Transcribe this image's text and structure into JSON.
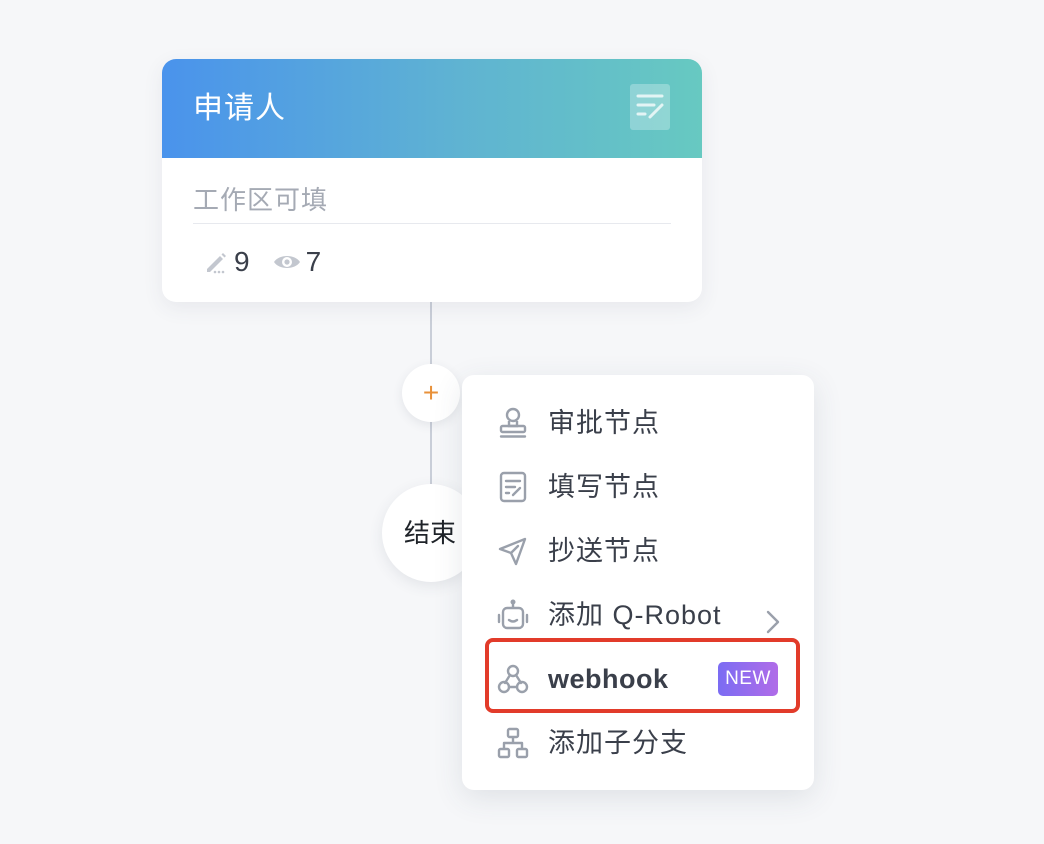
{
  "card": {
    "title": "申请人",
    "header_icon": "form-edit-icon",
    "placeholder": "工作区可填",
    "edit_count": "9",
    "view_count": "7",
    "edit_icon": "pencil-icon",
    "view_icon": "eye-icon"
  },
  "add_button": {
    "symbol": "+"
  },
  "end_node": {
    "label": "结束"
  },
  "menu": {
    "items": [
      {
        "label": "审批节点",
        "icon": "stamp-icon"
      },
      {
        "label": "填写节点",
        "icon": "form-icon"
      },
      {
        "label": "抄送节点",
        "icon": "send-icon"
      },
      {
        "label": "添加 Q-Robot",
        "icon": "robot-icon",
        "has_submenu": true
      },
      {
        "label": "webhook",
        "icon": "webhook-icon",
        "badge": "NEW",
        "highlighted": true
      },
      {
        "label": "添加子分支",
        "icon": "branch-icon"
      }
    ]
  },
  "colors": {
    "header_gradient_start": "#4a93ec",
    "header_gradient_end": "#67c9c1",
    "add_accent": "#e8913a",
    "badge_start": "#7b6cf3",
    "badge_end": "#b06ce8",
    "highlight": "#e23b2a"
  }
}
